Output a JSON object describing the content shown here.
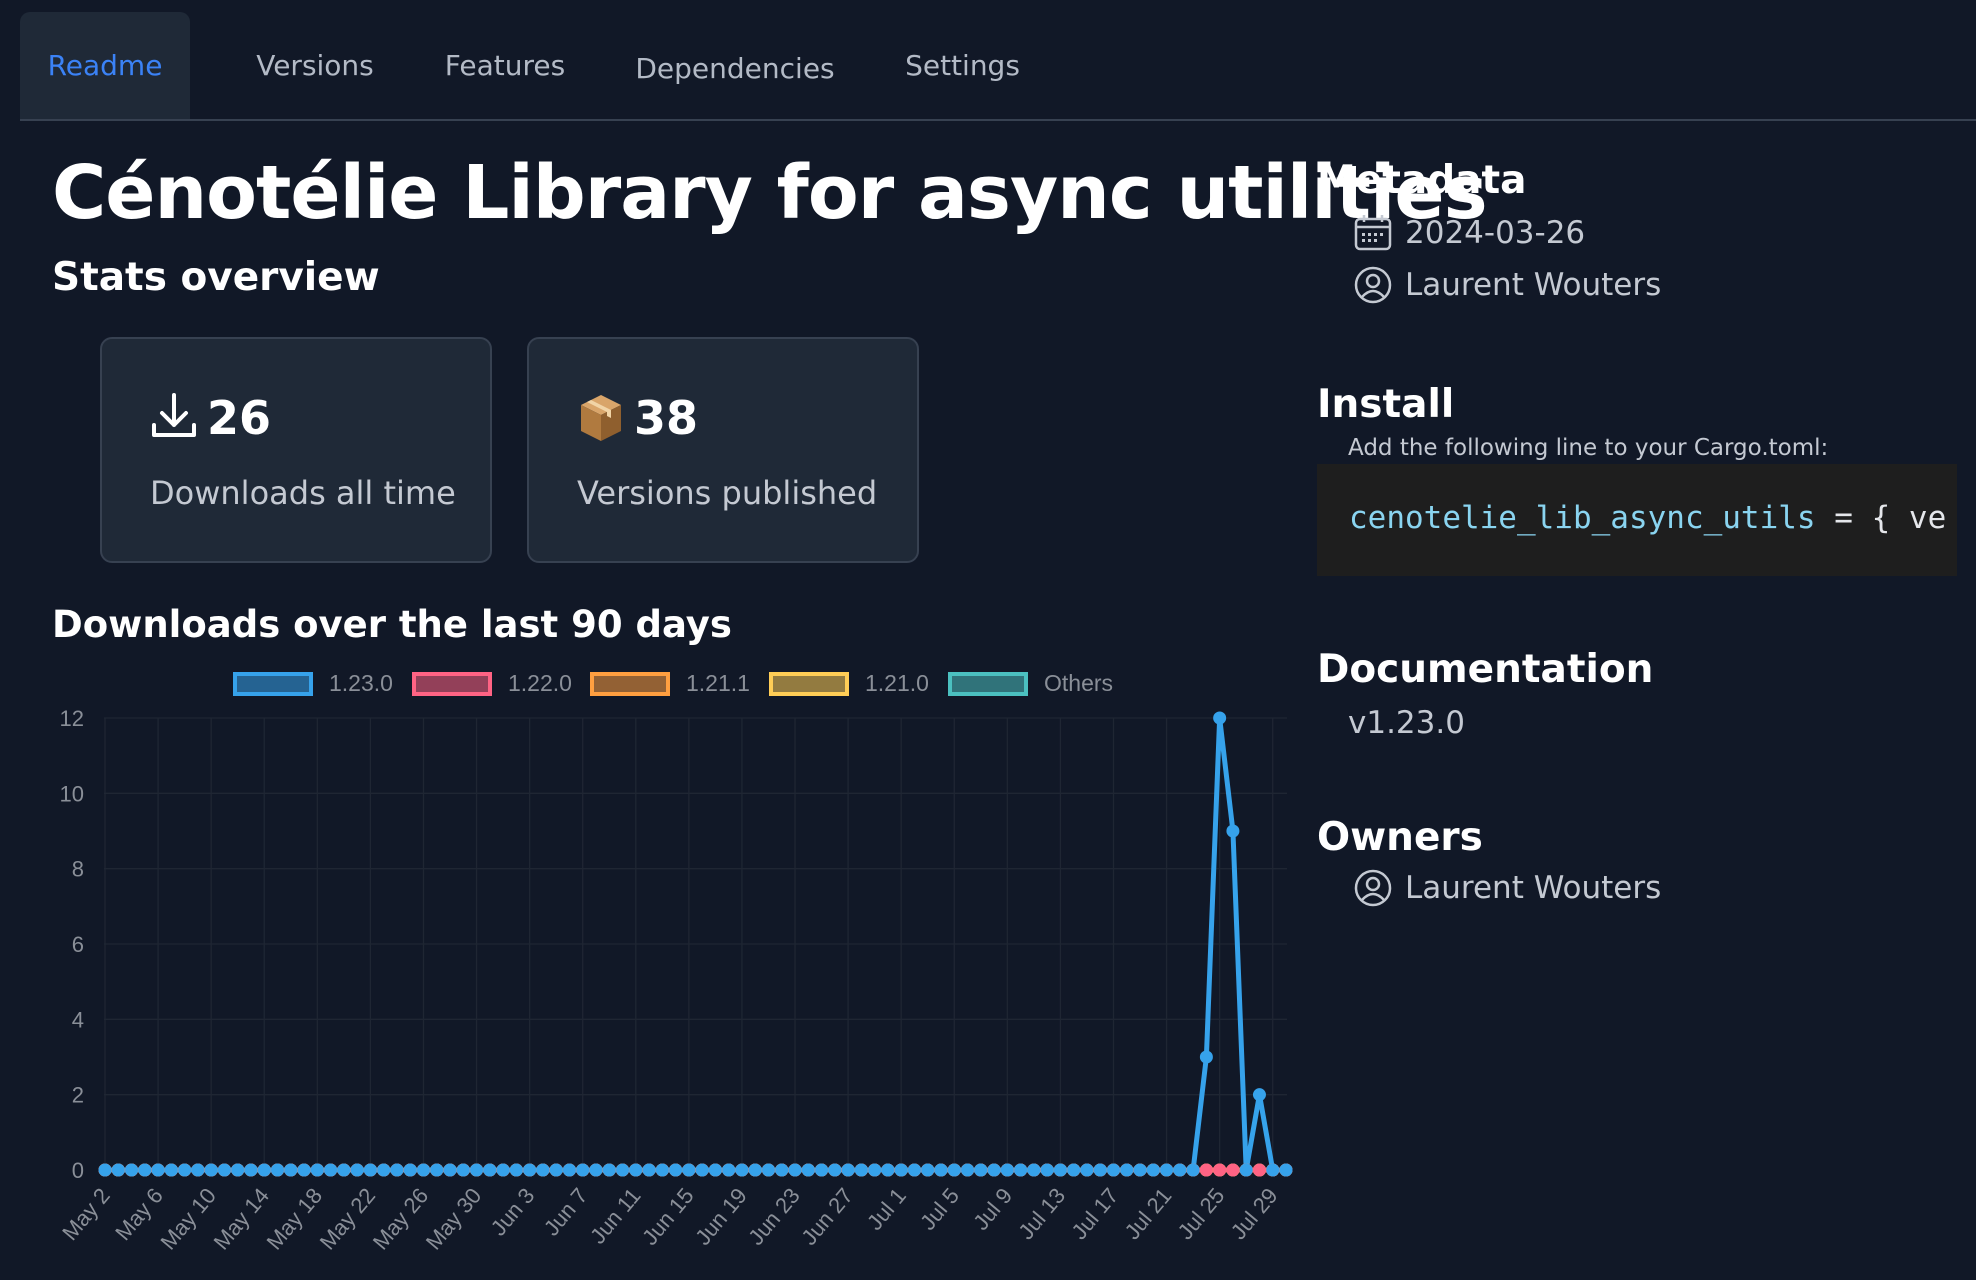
{
  "tabs": [
    {
      "label": "Readme",
      "active": true
    },
    {
      "label": "Versions",
      "active": false
    },
    {
      "label": "Features",
      "active": false
    },
    {
      "label": "Dependencies",
      "active": false
    },
    {
      "label": "Settings",
      "active": false
    }
  ],
  "page": {
    "title": "Cénotélie Library for async utilities",
    "stats_heading": "Stats overview",
    "downloads_heading": "Downloads over the last 90 days"
  },
  "stats": [
    {
      "icon": "download-icon",
      "value": "26",
      "label": "Downloads all time"
    },
    {
      "icon": "package-icon",
      "value": "38",
      "label": "Versions published"
    }
  ],
  "sidebar": {
    "metadata_heading": "Metadata",
    "date": "2024-03-26",
    "author": "Laurent Wouters",
    "install_heading": "Install",
    "install_hint": "Add the following line to your Cargo.toml:",
    "install_code_ident": "cenotelie_lib_async_utils",
    "install_code_rest": " = { ve",
    "documentation_heading": "Documentation",
    "doc_version": "v1.23.0",
    "owners_heading": "Owners",
    "owner": "Laurent Wouters"
  },
  "colors": {
    "accent": "#3b82f6",
    "series": [
      "#36a2eb",
      "#ff6384",
      "#ff9f40",
      "#ffcd56",
      "#4bc0c0"
    ]
  },
  "chart_data": {
    "type": "line",
    "title": "",
    "xlabel": "",
    "ylabel": "",
    "ylim": [
      0,
      12
    ],
    "yticks": [
      0,
      2,
      4,
      6,
      8,
      10,
      12
    ],
    "grid": true,
    "legend_position": "top",
    "x_tick_labels": [
      "May 2",
      "May 6",
      "May 10",
      "May 14",
      "May 18",
      "May 22",
      "May 26",
      "May 30",
      "Jun 3",
      "Jun 7",
      "Jun 11",
      "Jun 15",
      "Jun 19",
      "Jun 23",
      "Jun 27",
      "Jul 1",
      "Jul 5",
      "Jul 9",
      "Jul 13",
      "Jul 17",
      "Jul 21",
      "Jul 25",
      "Jul 29"
    ],
    "x_start": "May 2",
    "x_end": "Jul 30",
    "series": [
      {
        "name": "1.23.0",
        "color": "#36a2eb",
        "nonzero": [
          [
            "Jul 24",
            3
          ],
          [
            "Jul 25",
            12
          ],
          [
            "Jul 26",
            9
          ],
          [
            "Jul 28",
            2
          ]
        ]
      },
      {
        "name": "1.22.0",
        "color": "#ff6384",
        "nonzero": []
      },
      {
        "name": "1.21.1",
        "color": "#ff9f40",
        "nonzero": []
      },
      {
        "name": "1.21.0",
        "color": "#ffcd56",
        "nonzero": []
      },
      {
        "name": "Others",
        "color": "#4bc0c0",
        "nonzero": []
      }
    ]
  }
}
